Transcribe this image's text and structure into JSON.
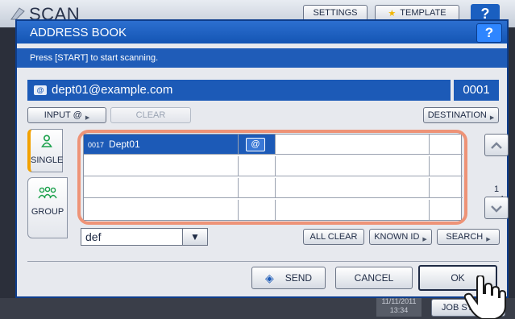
{
  "background": {
    "app_title": "SCAN",
    "settings_label": "SETTINGS",
    "template_label": "TEMPLATE",
    "help_label": "?",
    "clock": {
      "date": "11/11/2011",
      "time": "13:34"
    },
    "job_status_label": "JOB STATUS"
  },
  "dialog": {
    "title": "ADDRESS BOOK",
    "help_label": "?",
    "message": "Press [START] to start scanning.",
    "destination_address": "dept01@example.com",
    "destination_count": "0001",
    "input_email_label": "INPUT @",
    "clear_label": "CLEAR",
    "destination_label": "DESTINATION",
    "tabs": [
      {
        "label": "SINGLE",
        "icon": "single-user-icon",
        "active": true
      },
      {
        "label": "GROUP",
        "icon": "group-users-icon",
        "active": false
      }
    ],
    "entries": [
      {
        "number": "0017",
        "name": "Dept01",
        "has_email": true,
        "email_icon": "@"
      },
      {
        "number": "",
        "name": "",
        "has_email": false,
        "email_icon": ""
      },
      {
        "number": "",
        "name": "",
        "has_email": false,
        "email_icon": ""
      },
      {
        "number": "",
        "name": "",
        "has_email": false,
        "email_icon": ""
      }
    ],
    "page": {
      "current": "1",
      "total": "1"
    },
    "filter_value": "def",
    "all_clear_label": "ALL CLEAR",
    "known_id_label": "KNOWN ID",
    "search_label": "SEARCH",
    "send_label": "SEND",
    "cancel_label": "CANCEL",
    "ok_label": "OK"
  },
  "colors": {
    "title_bar": "#1455b4",
    "selection": "#1c5ab7",
    "highlight_ring": "#ee9377",
    "active_tab_accent": "#f2a100"
  }
}
